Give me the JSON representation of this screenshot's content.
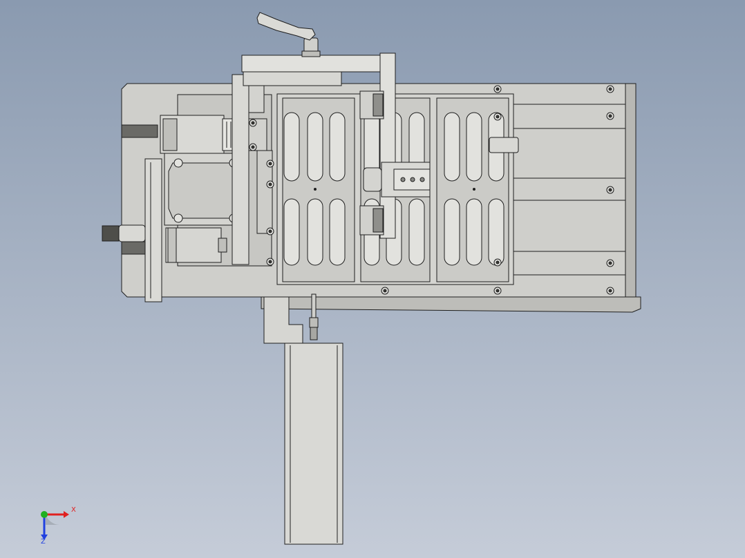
{
  "viewport": {
    "background_top": "#8A9AB0",
    "background_bottom": "#C5CCD8"
  },
  "part_colors": {
    "body": "#CFCFCB",
    "body_light": "#DADAD6",
    "body_dark": "#A9A9A5",
    "edge": "#1E1E1E",
    "rail": "#6A6A66"
  },
  "triad": {
    "x_label": "X",
    "z_label": "Z",
    "x_color": "#E02020",
    "y_color": "#20B020",
    "z_color": "#2040E0"
  }
}
